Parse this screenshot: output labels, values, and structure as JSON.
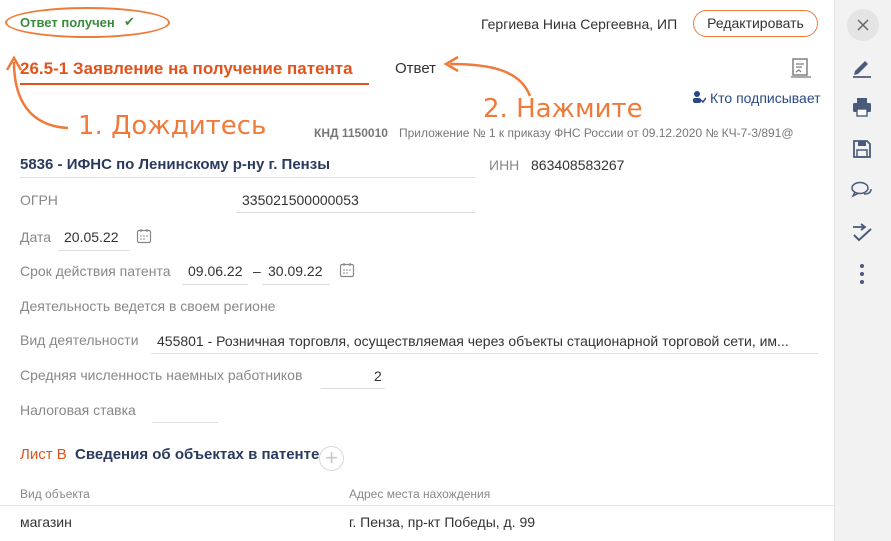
{
  "header": {
    "status": "Ответ получен",
    "status_check": "✔",
    "user": "Гергиева Нина Сергеевна, ИП",
    "edit_label": "Редактировать"
  },
  "document": {
    "title": "26.5-1 Заявление на получение патента",
    "answer_tab": "Ответ",
    "signers_label": "Кто подписывает",
    "knd_code": "КНД 1150010",
    "knd_rest": "Приложение № 1 к приказу ФНС России от 09.12.2020 № КЧ-7-3/891@"
  },
  "annotations": {
    "step1": "1. Дождитесь",
    "step2": "2. Нажмите",
    "color": "#f07a3a"
  },
  "form": {
    "ifns": "5836 - ИФНС по Ленинскому р-ну г. Пензы",
    "inn_label": "ИНН",
    "inn_value": "863408583267",
    "ogrn_label": "ОГРН",
    "ogrn_value": "335021500000053",
    "date_label": "Дата",
    "date_value": "20.05.22",
    "period_label": "Срок действия патента",
    "period_from": "09.06.22",
    "period_dash": "–",
    "period_to": "30.09.22",
    "region_label": "Деятельность ведется в своем регионе",
    "activity_label": "Вид деятельности",
    "activity_value": "455801 - Розничная торговля, осуществляемая через объекты стационарной торговой сети, им...",
    "workers_label": "Средняя численность наемных работников",
    "workers_value": "2",
    "tax_label": "Налоговая ставка"
  },
  "sheet": {
    "label": "Лист В",
    "title": "Сведения об объектах в патенте",
    "add_symbol": "+",
    "columns": [
      "Вид объекта",
      "Адрес места нахождения"
    ],
    "rows": [
      {
        "type": "магазин",
        "address": "г. Пенза, пр-кт Победы, д. 99"
      }
    ]
  },
  "sidebar": {
    "icons": [
      "close-icon",
      "sign-icon",
      "print-icon",
      "save-icon",
      "comments-icon",
      "check-send-icon",
      "more-icon"
    ]
  },
  "colors": {
    "accent": "#e2531b",
    "success": "#3a8a3c",
    "link": "#2a4a86",
    "annotation": "#f07a3a"
  }
}
